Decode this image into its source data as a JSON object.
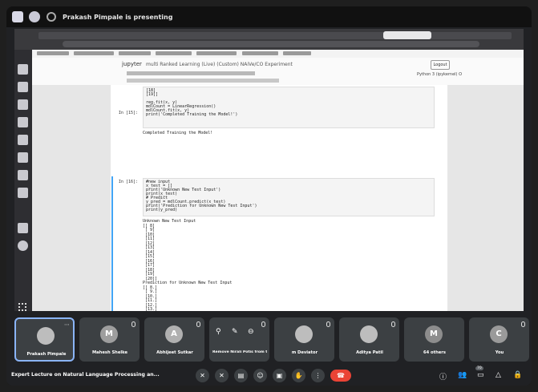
{
  "presenter_banner": {
    "text": "Prakash Pimpale is presenting"
  },
  "notebook": {
    "logo": "jupyter",
    "title": "multi Ranked Learning (Live) (Custom) NAiVe/CO Experiment",
    "logout_label": "Logout",
    "kernel_label": "Python 3 (ipykernel) O",
    "cell_15": {
      "prompt": "In [15]:",
      "code": "[18]\n[19]]\n\nreg.fit(x, y)\nmdlCount = LinearRegression()\nmdlCount.fit(x, y)\nprint('Completed Training the Model!')",
      "output": "Completed Training the Model!"
    },
    "cell_16": {
      "prompt": "In [16]:",
      "code": "#new input\nx_test = []\nprint('Unknown New Test Input')\nprint(x_test)\n# Predict\ny_pred = mdlCount.predict(x_test)\nprint('Prediction for Unknown New Test Input')\nprint(y_pred)",
      "output": "Unknown New Test Input\n[[ 8]\n [ 9]\n [10]\n [11]\n [12]\n [13]\n [14]\n [15]\n [16]\n [17]\n [18]\n [19]\n [20]]\nPrediction for Unknown New Test Input\n[[ 8.]\n [ 9.]\n [10.]\n [11.]\n [12.]\n [13.]\n [14.]\n [15.]\n [16.]\n [17.]\n [18.]\n [19.]\n [20.]]"
    }
  },
  "participants": [
    {
      "name": "Prakash Pimpale",
      "initial": "",
      "photo": true
    },
    {
      "name": "Mahesh Shelke",
      "initial": "M",
      "photo": false
    },
    {
      "name": "Abhijeet Sutkar",
      "initial": "A",
      "photo": false
    },
    {
      "name": "Remove Nirali Potis from the call",
      "initial": "",
      "photo": false
    },
    {
      "name": "m Deviator",
      "initial": "",
      "photo": true
    },
    {
      "name": "Aditya Patil",
      "initial": "",
      "photo": true
    },
    {
      "name": "64 others",
      "initial": "M",
      "photo": false
    },
    {
      "name": "You",
      "initial": "C",
      "photo": false
    }
  ],
  "meeting_title": "Expert Lecture on Natural Language Processing an...",
  "people_badge": "70",
  "colors": {
    "end_call": "#ea4335",
    "active_tile_border": "#8ab4f8",
    "cell_selected": "#42a5f5"
  }
}
